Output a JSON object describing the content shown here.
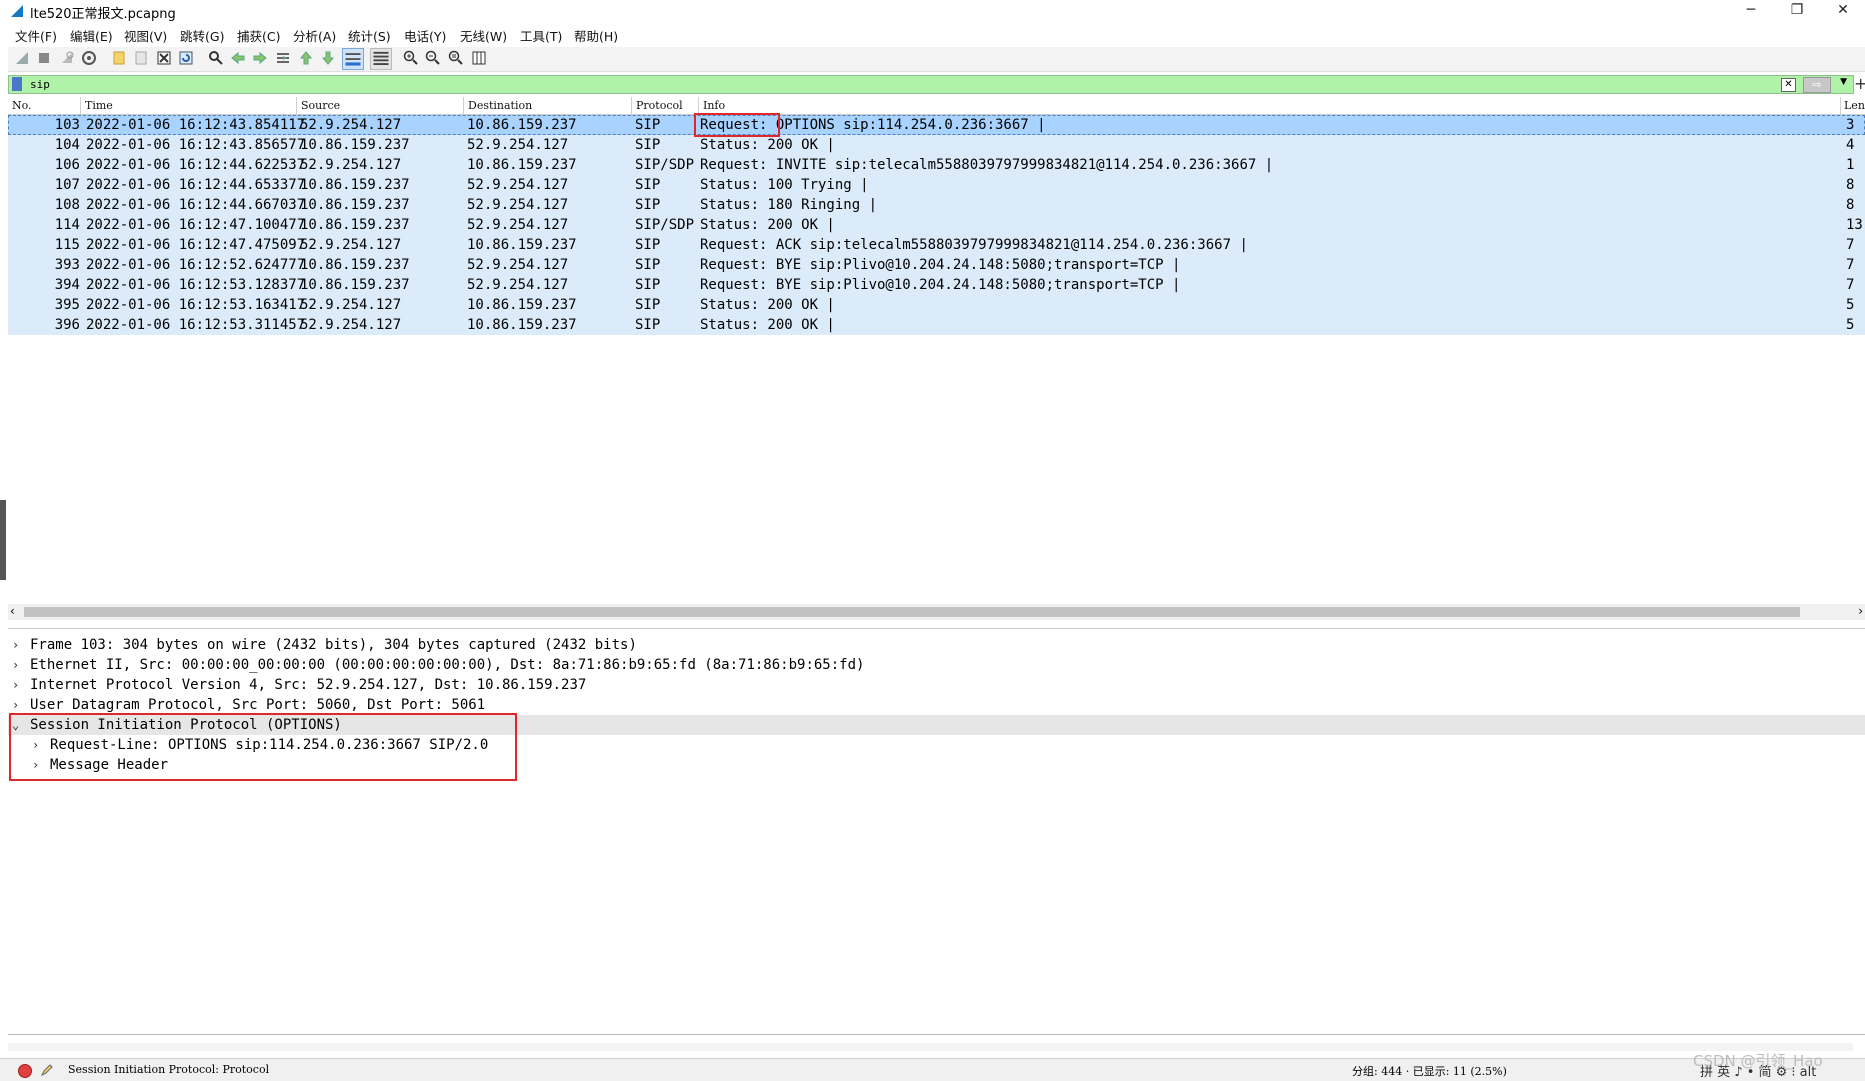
{
  "window": {
    "title": "lte520正常报文.pcapng",
    "minimize": "─",
    "maximize": "❐",
    "close": "✕"
  },
  "menu": [
    "文件(F)",
    "编辑(E)",
    "视图(V)",
    "跳转(G)",
    "捕获(C)",
    "分析(A)",
    "统计(S)",
    "电话(Y)",
    "无线(W)",
    "工具(T)",
    "帮助(H)"
  ],
  "filter": {
    "value": "sip",
    "add": "+"
  },
  "columns": {
    "no": "No.",
    "time": "Time",
    "source": "Source",
    "destination": "Destination",
    "protocol": "Protocol",
    "info": "Info",
    "length": "Leng"
  },
  "packets": [
    {
      "no": "103",
      "time": "2022-01-06 16:12:43.854117",
      "source": "52.9.254.127",
      "destination": "10.86.159.237",
      "protocol": "SIP",
      "info": "Request: OPTIONS sip:114.254.0.236:3667 |",
      "length": "3"
    },
    {
      "no": "104",
      "time": "2022-01-06 16:12:43.856577",
      "source": "10.86.159.237",
      "destination": "52.9.254.127",
      "protocol": "SIP",
      "info": "Status: 200 OK |",
      "length": "4"
    },
    {
      "no": "106",
      "time": "2022-01-06 16:12:44.622537",
      "source": "52.9.254.127",
      "destination": "10.86.159.237",
      "protocol": "SIP/SDP",
      "info": "Request: INVITE sip:telecalm5588039797999834821@114.254.0.236:3667 |",
      "length": "1"
    },
    {
      "no": "107",
      "time": "2022-01-06 16:12:44.653377",
      "source": "10.86.159.237",
      "destination": "52.9.254.127",
      "protocol": "SIP",
      "info": "Status: 100 Trying |",
      "length": "8"
    },
    {
      "no": "108",
      "time": "2022-01-06 16:12:44.667037",
      "source": "10.86.159.237",
      "destination": "52.9.254.127",
      "protocol": "SIP",
      "info": "Status: 180 Ringing |",
      "length": "8"
    },
    {
      "no": "114",
      "time": "2022-01-06 16:12:47.100477",
      "source": "10.86.159.237",
      "destination": "52.9.254.127",
      "protocol": "SIP/SDP",
      "info": "Status: 200 OK |",
      "length": "13"
    },
    {
      "no": "115",
      "time": "2022-01-06 16:12:47.475097",
      "source": "52.9.254.127",
      "destination": "10.86.159.237",
      "protocol": "SIP",
      "info": "Request: ACK sip:telecalm5588039797999834821@114.254.0.236:3667 |",
      "length": "7"
    },
    {
      "no": "393",
      "time": "2022-01-06 16:12:52.624777",
      "source": "10.86.159.237",
      "destination": "52.9.254.127",
      "protocol": "SIP",
      "info": "Request: BYE sip:Plivo@10.204.24.148:5080;transport=TCP |",
      "length": "7"
    },
    {
      "no": "394",
      "time": "2022-01-06 16:12:53.128377",
      "source": "10.86.159.237",
      "destination": "52.9.254.127",
      "protocol": "SIP",
      "info": "Request: BYE sip:Plivo@10.204.24.148:5080;transport=TCP |",
      "length": "7"
    },
    {
      "no": "395",
      "time": "2022-01-06 16:12:53.163417",
      "source": "52.9.254.127",
      "destination": "10.86.159.237",
      "protocol": "SIP",
      "info": "Status: 200 OK |",
      "length": "5"
    },
    {
      "no": "396",
      "time": "2022-01-06 16:12:53.311457",
      "source": "52.9.254.127",
      "destination": "10.86.159.237",
      "protocol": "SIP",
      "info": "Status: 200 OK |",
      "length": "5"
    }
  ],
  "details": [
    {
      "text": "Frame 103: 304 bytes on wire (2432 bits), 304 bytes captured (2432 bits)",
      "expanded": false
    },
    {
      "text": "Ethernet II, Src: 00:00:00_00:00:00 (00:00:00:00:00:00), Dst: 8a:71:86:b9:65:fd (8a:71:86:b9:65:fd)",
      "expanded": false
    },
    {
      "text": "Internet Protocol Version 4, Src: 52.9.254.127, Dst: 10.86.159.237",
      "expanded": false
    },
    {
      "text": "User Datagram Protocol, Src Port: 5060, Dst Port: 5061",
      "expanded": false
    },
    {
      "text": "Session Initiation Protocol (OPTIONS)",
      "expanded": true
    },
    {
      "text": "Request-Line: OPTIONS sip:114.254.0.236:3667 SIP/2.0",
      "expanded": false,
      "child": true
    },
    {
      "text": "Message Header",
      "expanded": false,
      "child": true
    }
  ],
  "status": {
    "text": "Session Initiation Protocol: Protocol",
    "packets": "分组: 444 · 已显示: 11 (2.5%)",
    "ime": "拼 英 ♪ • 简 ⚙ ⁝ alt"
  },
  "watermark": "CSDN @引领_Hao",
  "colors": {
    "filter_bg": "#aff2a8",
    "row_bg": "#dcebfa",
    "selected_row_bg": "#a8d2ff",
    "highlight_box": "#e0272a"
  }
}
